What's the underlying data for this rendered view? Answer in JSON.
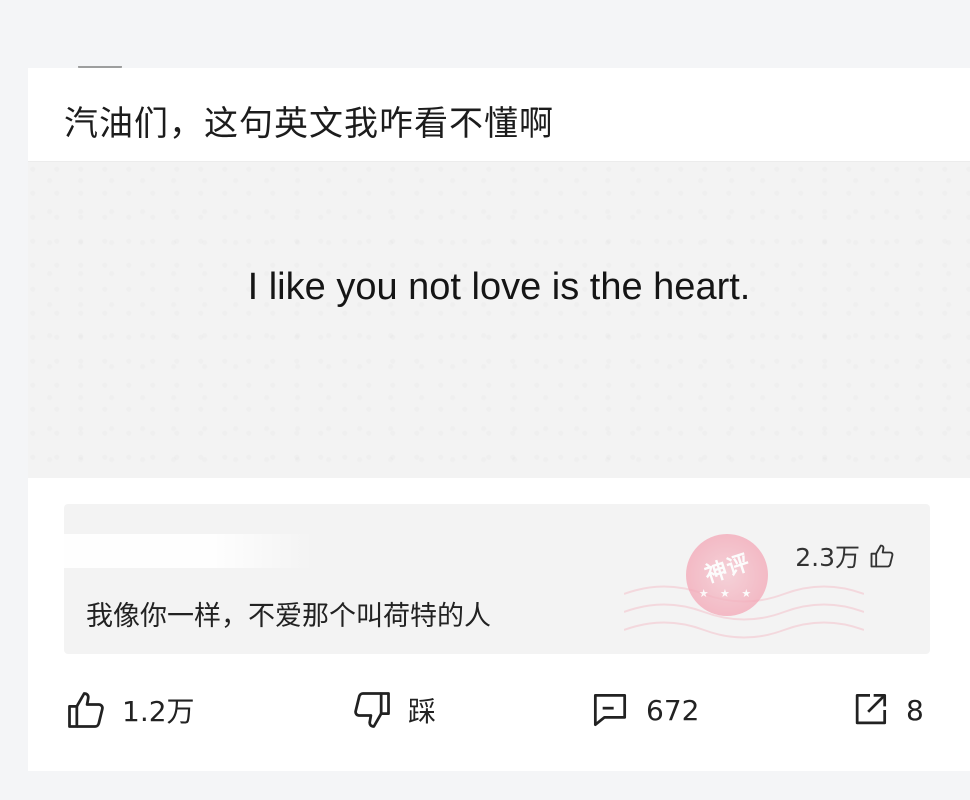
{
  "post": {
    "title": "汽油们，这句英文我咋看不懂啊",
    "image_text": "I like you not love is the heart."
  },
  "top_comment": {
    "text": "我像你一样，不爱那个叫荷特的人",
    "likes": "2.3万",
    "badge": {
      "label": "神评",
      "dots": "★ ★ ★",
      "color": "#f3a7b6"
    }
  },
  "actions": {
    "like": "1.2万",
    "dislike": "踩",
    "comments": "672",
    "share": "8"
  },
  "icons": {
    "like": "thumbs-up-icon",
    "dislike": "thumbs-down-icon",
    "comment": "comment-bubble-icon",
    "share": "share-arrow-icon",
    "comment_like": "thumbs-up-icon"
  }
}
